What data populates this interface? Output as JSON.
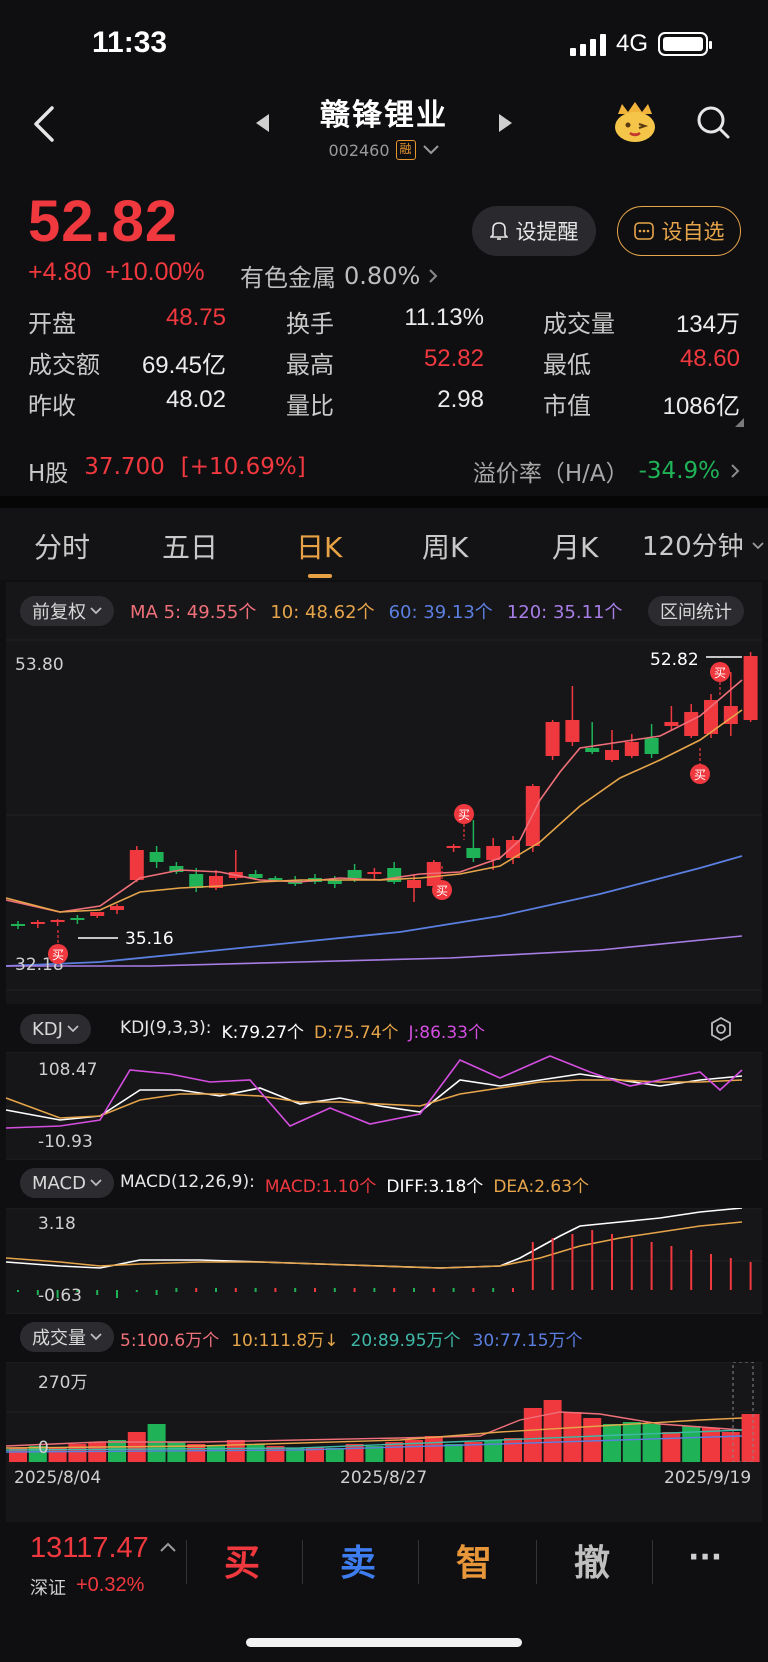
{
  "status": {
    "time": "11:33",
    "network": "4G"
  },
  "header": {
    "title": "赣锋锂业",
    "code": "002460",
    "margin_badge": "融"
  },
  "quote": {
    "price": "52.82",
    "change": "+4.80",
    "change_pct": "+10.00%",
    "sector": "有色金属",
    "sector_pct": "0.80%",
    "alert_label": "设提醒",
    "watch_label": "设自选"
  },
  "stats": {
    "open_label": "开盘",
    "open": "48.75",
    "turnover_label": "换手",
    "turnover": "11.13%",
    "volume_label": "成交量",
    "volume": "134万",
    "amount_label": "成交额",
    "amount": "69.45亿",
    "high_label": "最高",
    "high": "52.82",
    "low_label": "最低",
    "low": "48.60",
    "prev_label": "昨收",
    "prev": "48.02",
    "ratio_label": "量比",
    "ratio": "2.98",
    "mcap_label": "市值",
    "mcap": "1086亿"
  },
  "hshare": {
    "label": "H股",
    "price": "37.700",
    "pct": "[+10.69%]",
    "premium_label": "溢价率（H/A）",
    "premium": "-34.9%"
  },
  "tabs": [
    "分时",
    "五日",
    "日K",
    "周K",
    "月K",
    "120分钟"
  ],
  "kline": {
    "adjust_label": "前复权",
    "ma5": "MA 5: 49.55个",
    "ma10": "10: 48.62个",
    "ma60": "60: 39.13个",
    "ma120": "120: 35.11个",
    "range_label": "区间统计",
    "top_axis": "53.80",
    "bottom_axis": "32.18",
    "max_label": "52.82",
    "min_label": "35.16",
    "buy_marker": "买"
  },
  "kdj": {
    "tab": "KDJ",
    "params": "KDJ(9,3,3):",
    "k": "K:79.27个",
    "d": "D:75.74个",
    "j": "J:86.33个",
    "top": "108.47",
    "bottom": "-10.93"
  },
  "macd": {
    "tab": "MACD",
    "params": "MACD(12,26,9):",
    "macd": "MACD:1.10个",
    "diff": "DIFF:3.18个",
    "dea": "DEA:2.63个",
    "top": "3.18",
    "bottom": "-0.63"
  },
  "vol": {
    "tab": "成交量",
    "ma5": "5:100.6万个",
    "ma10": "10:111.8万↓",
    "ma20": "20:89.95万个",
    "ma30": "30:77.15万个",
    "top": "270万",
    "zero": "0"
  },
  "dates": [
    "2025/8/04",
    "2025/8/27",
    "2025/9/19"
  ],
  "bottom": {
    "index_val": "13117.47",
    "index_name": "深证",
    "index_chg": "+0.32%",
    "buy": "买",
    "sell": "卖",
    "smart": "智",
    "cancel": "撤",
    "more": "···"
  },
  "colors": {
    "up": "#f0383f",
    "down": "#1fb257",
    "ma5": "#f0707a",
    "ma10": "#e6a54a",
    "ma60": "#5b7fe0",
    "ma120": "#a77de6",
    "accent": "#e8a246"
  }
}
